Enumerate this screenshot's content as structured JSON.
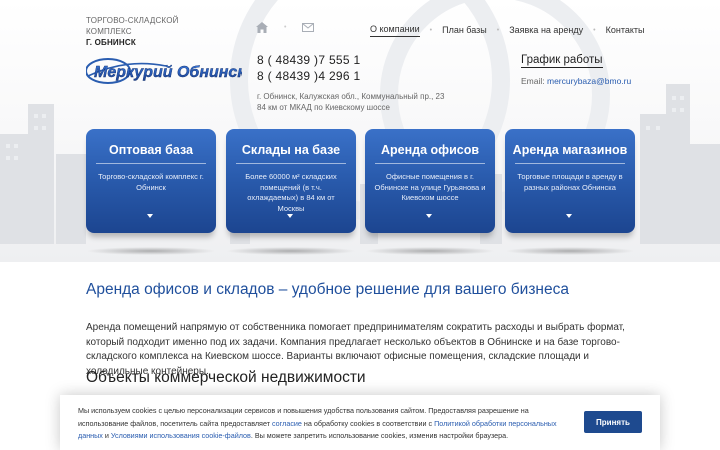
{
  "header": {
    "company_line1": "ТОРГОВО-СКЛАДСКОЙ",
    "company_line2": "КОМПЛЕКС",
    "company_city": "Г. ОБНИНСК",
    "logo_text": "Меркурий Обнинск",
    "icons": [
      "home-icon",
      "mail-icon"
    ],
    "nav": [
      {
        "label": "О компании",
        "active": true
      },
      {
        "label": "План базы",
        "active": false
      },
      {
        "label": "Заявка на аренду",
        "active": false
      },
      {
        "label": "Контакты",
        "active": false
      }
    ],
    "phone1": "8 ( 48439 )7 555 1",
    "phone2": "8 ( 48439 )4 296 1",
    "address_line1": "г. Обнинск, Калужская обл., Коммунальный пр., 23",
    "address_line2": "84 км от МКАД по Киевскому шоссе",
    "schedule_link": "График работы",
    "email_label": "Email:",
    "email_value": "mercurybaza@bmo.ru"
  },
  "cards": [
    {
      "title": "Оптовая база",
      "text": "Торгово-складской комплекс г. Обнинск"
    },
    {
      "title": "Склады на базе",
      "text": "Более 60000 м² складских помещений (в т.ч. охлаждаемых) в 84 км от Москвы"
    },
    {
      "title": "Аренда офисов",
      "text": "Офисные помещения в г. Обнинске на улице Гурьянова и Киевском шоссе"
    },
    {
      "title": "Аренда магазинов",
      "text": "Торговые площади в аренду в разных районах Обнинска"
    }
  ],
  "main": {
    "headline": "Аренда офисов и складов – удобное решение для вашего бизнеса",
    "paragraph": "Аренда помещений напрямую от собственника помогает предпринимателям сократить расходы и выбрать формат, который подходит именно под их задачи. Компания предлагает несколько объектов в Обнинске и на базе торгово-складского комплекса на Киевском шоссе. Варианты включают офисные помещения, складские площади и холодильные контейнеры.",
    "subheading": "Объекты коммерческой недвижимости"
  },
  "cookie": {
    "text_part1": "Мы используем cookies с целью персонализации сервисов и повышения удобства пользования сайтом. Предоставляя разрешение на использование файлов, посетитель сайта предоставляет ",
    "link1": "согласие",
    "text_part2": " на обработку cookies в соответствии с ",
    "link2": "Политикой обработки персональных данных",
    "text_part3": " и ",
    "link3": "Условиями использования cookie-файлов",
    "text_part4": ". Вы можете запретить использование cookies, изменив настройки браузера.",
    "accept_label": "Принять"
  },
  "colors": {
    "brand_blue": "#1f4f9c",
    "card_gradient_top": "#3a71c8",
    "card_gradient_bottom": "#1c4590",
    "button_blue": "#1e4a8f",
    "link_blue": "#2a5db0"
  }
}
